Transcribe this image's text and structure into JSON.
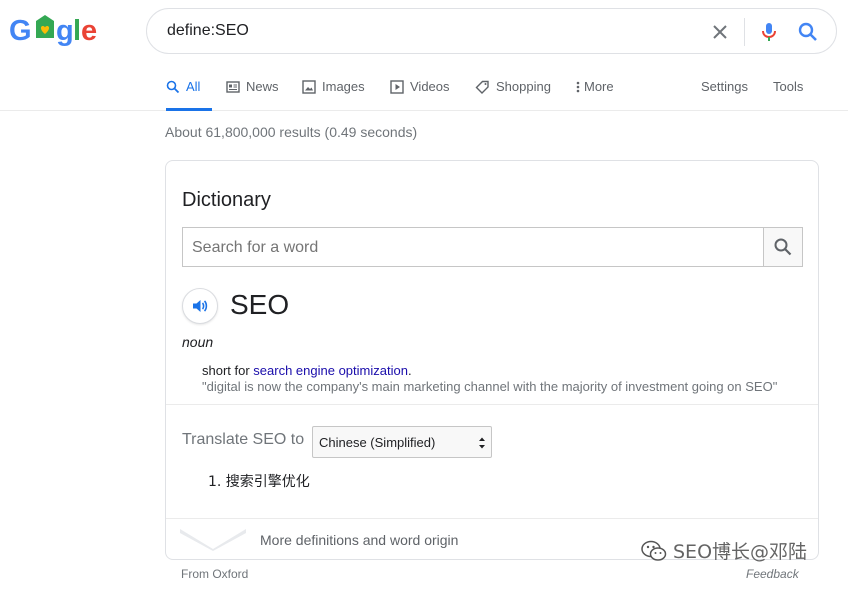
{
  "logo": {
    "text": "Google",
    "colors": [
      "#4285f4",
      "#ea4335",
      "#fbbc05",
      "#4285f4",
      "#34a853",
      "#ea4335"
    ]
  },
  "search": {
    "query": "define:SEO"
  },
  "tabs": [
    {
      "label": "All",
      "icon": "search-icon",
      "active": true
    },
    {
      "label": "News",
      "icon": "news-icon"
    },
    {
      "label": "Images",
      "icon": "image-icon"
    },
    {
      "label": "Videos",
      "icon": "play-icon"
    },
    {
      "label": "Shopping",
      "icon": "tag-icon"
    },
    {
      "label": "More",
      "icon": "more-vert-icon"
    }
  ],
  "tools": {
    "settings": "Settings",
    "tools": "Tools"
  },
  "stats": "About 61,800,000 results (0.49 seconds)",
  "dictionary": {
    "title": "Dictionary",
    "search_placeholder": "Search for a word",
    "word": "SEO",
    "part_of_speech": "noun",
    "definition_prefix": "short for ",
    "definition_link": "search engine optimization",
    "definition_suffix": ".",
    "example": "\"digital is now the company's main marketing channel with the majority of investment going on SEO\"",
    "translate_label": "Translate SEO to",
    "translate_language": "Chinese (Simplified)",
    "translation": "1. 搜索引擎优化",
    "more_link": "More definitions and word origin"
  },
  "footer": {
    "source": "From Oxford",
    "feedback": "Feedback"
  },
  "watermark": {
    "text": "SEO博长@邓陆",
    "icon": "wechat-icon"
  },
  "colors": {
    "accent": "#1a73e8",
    "link": "#1a0dab",
    "muted": "#70757a"
  }
}
